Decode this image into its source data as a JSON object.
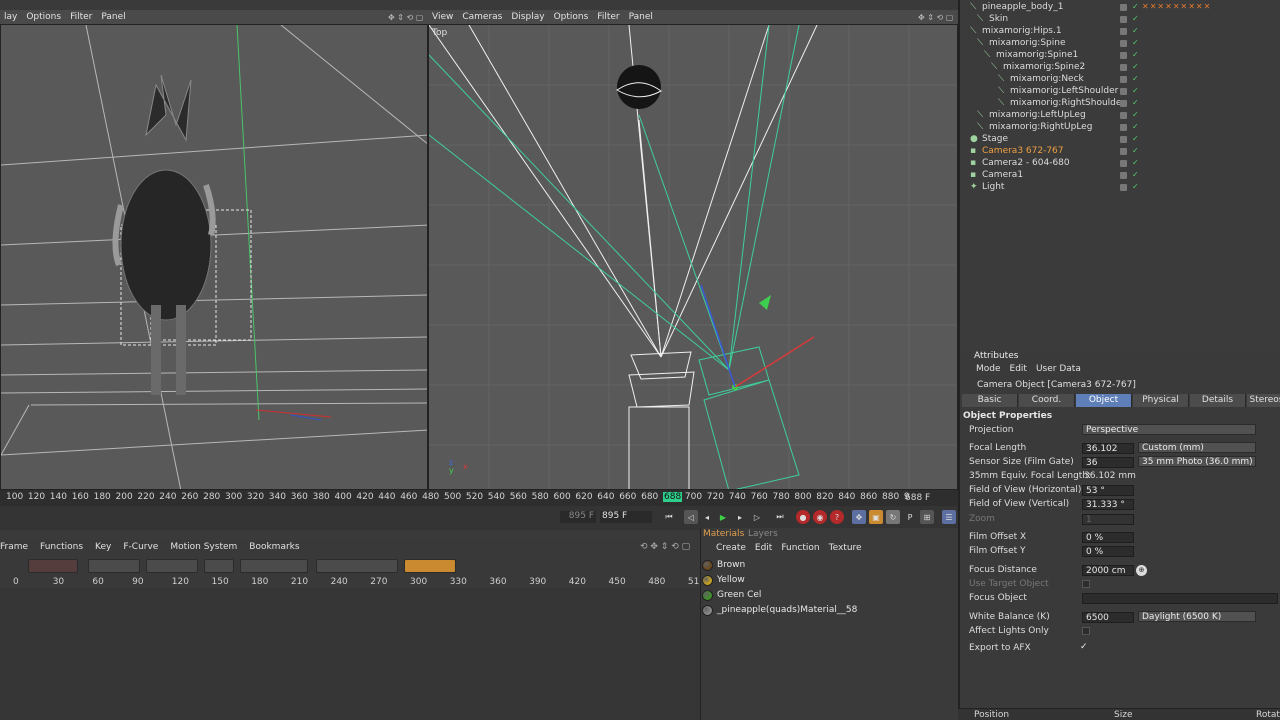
{
  "left_viewport": {
    "menu": [
      "lay",
      "Options",
      "Filter",
      "Panel"
    ]
  },
  "right_viewport": {
    "menu": [
      "View",
      "Cameras",
      "Display",
      "Options",
      "Filter",
      "Panel"
    ],
    "label": "Top"
  },
  "ruler": {
    "ticks": [
      "100",
      "120",
      "140",
      "160",
      "180",
      "200",
      "220",
      "240",
      "260",
      "280",
      "300",
      "320",
      "340",
      "360",
      "380",
      "400",
      "420",
      "440",
      "460",
      "480",
      "500",
      "520",
      "540",
      "560",
      "580",
      "600",
      "620",
      "640",
      "660",
      "680",
      "688",
      "700",
      "720",
      "740",
      "760",
      "780",
      "800",
      "820",
      "840",
      "860",
      "880",
      "9"
    ],
    "current_frame": "688 F"
  },
  "transport": {
    "start_field": "895 F",
    "end_field": "895 F"
  },
  "timeline": {
    "menu": [
      "Frame",
      "Functions",
      "Key",
      "F-Curve",
      "Motion System",
      "Bookmarks"
    ],
    "numbers": [
      "0",
      "30",
      "60",
      "90",
      "120",
      "150",
      "180",
      "210",
      "240",
      "270",
      "300",
      "330",
      "360",
      "390",
      "420",
      "450",
      "480",
      "51"
    ]
  },
  "materials": {
    "tabs": [
      "Materials",
      "Layers"
    ],
    "menu": [
      "Create",
      "Edit",
      "Function",
      "Texture"
    ],
    "items": [
      {
        "name": "Brown",
        "color": "#6b4a1e"
      },
      {
        "name": "Yellow",
        "color": "#c9a321"
      },
      {
        "name": "Green Cel",
        "color": "#3e8f2a"
      },
      {
        "name": "_pineapple(quads)Material__58",
        "color": "#8a8a8a"
      }
    ]
  },
  "objects": {
    "rows": [
      {
        "name": "pineapple_body_1",
        "indent": 0,
        "highlight": false
      },
      {
        "name": "Skin",
        "indent": 1,
        "highlight": false
      },
      {
        "name": "mixamorig:Hips.1",
        "indent": 0,
        "highlight": false
      },
      {
        "name": "mixamorig:Spine",
        "indent": 1,
        "highlight": false
      },
      {
        "name": "mixamorig:Spine1",
        "indent": 2,
        "highlight": false
      },
      {
        "name": "mixamorig:Spine2",
        "indent": 3,
        "highlight": false
      },
      {
        "name": "mixamorig:Neck",
        "indent": 4,
        "highlight": false
      },
      {
        "name": "mixamorig:LeftShoulder",
        "indent": 4,
        "highlight": false
      },
      {
        "name": "mixamorig:RightShoulder",
        "indent": 4,
        "highlight": false
      },
      {
        "name": "mixamorig:LeftUpLeg",
        "indent": 1,
        "highlight": false
      },
      {
        "name": "mixamorig:RightUpLeg",
        "indent": 1,
        "highlight": false
      },
      {
        "name": "Stage",
        "indent": 0,
        "highlight": false
      },
      {
        "name": "Camera3 672-767",
        "indent": 0,
        "highlight": true
      },
      {
        "name": "Camera2 - 604-680",
        "indent": 0,
        "highlight": false
      },
      {
        "name": "Camera1",
        "indent": 0,
        "highlight": false
      },
      {
        "name": "Light",
        "indent": 0,
        "highlight": false
      }
    ]
  },
  "attributes": {
    "header": "Attributes",
    "menu": [
      "Mode",
      "Edit",
      "User Data"
    ],
    "object_title": "Camera Object [Camera3 672-767]",
    "tabs": [
      "Basic",
      "Coord.",
      "Object",
      "Physical",
      "Details",
      "Stereos"
    ],
    "active_tab": "Object",
    "section": "Object Properties",
    "projection_label": "Projection",
    "projection_value": "Perspective",
    "focal_length_label": "Focal Length",
    "focal_length_value": "36.102",
    "focal_length_preset": "Custom (mm)",
    "sensor_label": "Sensor Size (Film Gate)",
    "sensor_value": "36",
    "sensor_preset": "35 mm Photo (36.0 mm)",
    "equiv_label": "35mm Equiv. Focal Length:",
    "equiv_value": "36.102 mm",
    "fovh_label": "Field of View (Horizontal)",
    "fovh_value": "53 °",
    "fovv_label": "Field of View (Vertical)",
    "fovv_value": "31.333 °",
    "zoom_label": "Zoom",
    "zoom_value": "1",
    "offx_label": "Film Offset X",
    "offx_value": "0 %",
    "offy_label": "Film Offset Y",
    "offy_value": "0 %",
    "focus_label": "Focus Distance",
    "focus_value": "2000 cm",
    "target_label": "Use Target Object",
    "focus_obj_label": "Focus Object",
    "wb_label": "White Balance (K)",
    "wb_value": "6500",
    "wb_preset": "Daylight (6500 K)",
    "affect_label": "Affect Lights Only",
    "export_label": "Export to AFX",
    "export_check": "✓",
    "footer_left": "Position",
    "footer_mid": "Size",
    "footer_right": "Rotat"
  }
}
